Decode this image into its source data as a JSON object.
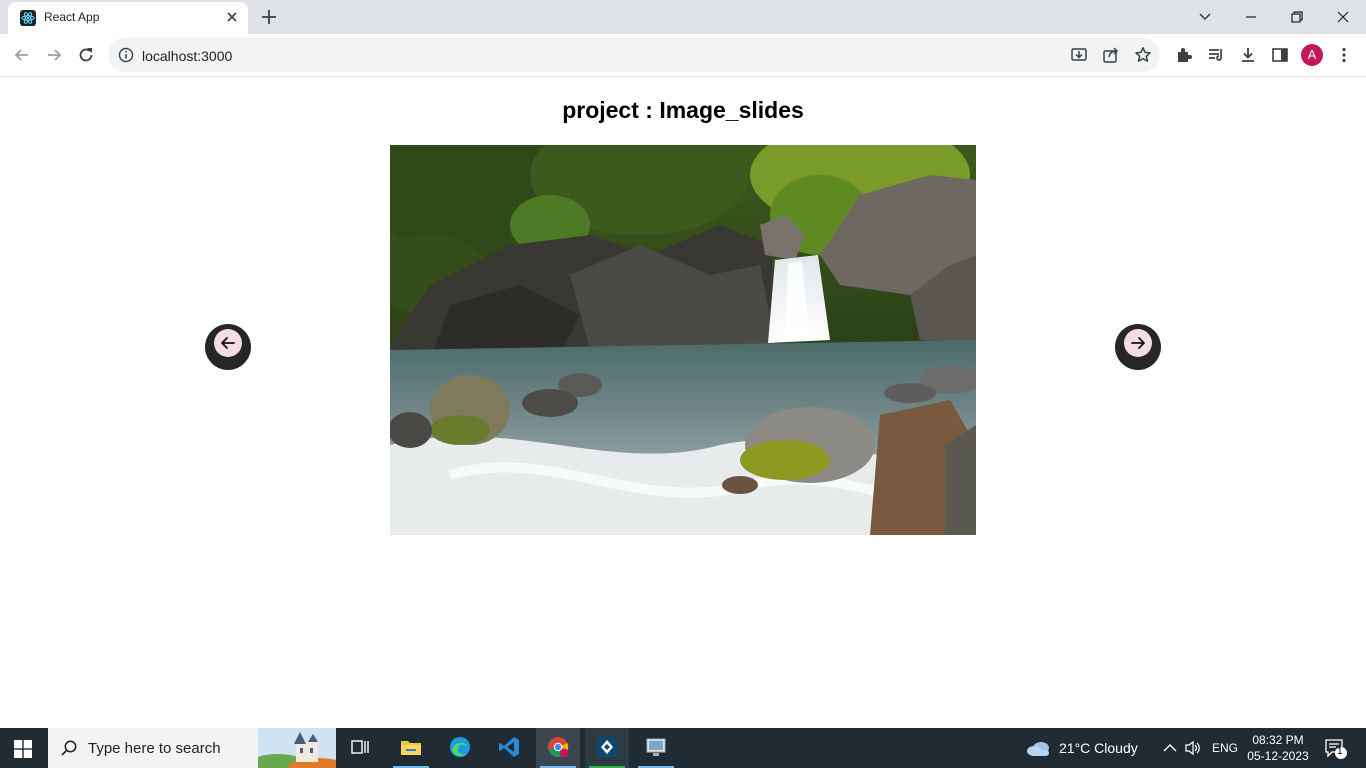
{
  "browser": {
    "tab_title": "React App",
    "url": "localhost:3000",
    "profile_initial": "A"
  },
  "page": {
    "title": "project : Image_slides",
    "slide_image": "waterfall-stream-photo",
    "prev_icon": "arrow-left-icon",
    "next_icon": "arrow-right-icon"
  },
  "taskbar": {
    "search_placeholder": "Type here to search",
    "weather": "21°C  Cloudy",
    "language": "ENG",
    "time": "08:32 PM",
    "date": "05-12-2023",
    "notification_count": "1"
  },
  "colors": {
    "tab_strip": "#dee1e6",
    "taskbar": "#202b33",
    "nav_button": "#262626",
    "nav_button_inner": "#f3dde3",
    "avatar": "#c2185b"
  }
}
